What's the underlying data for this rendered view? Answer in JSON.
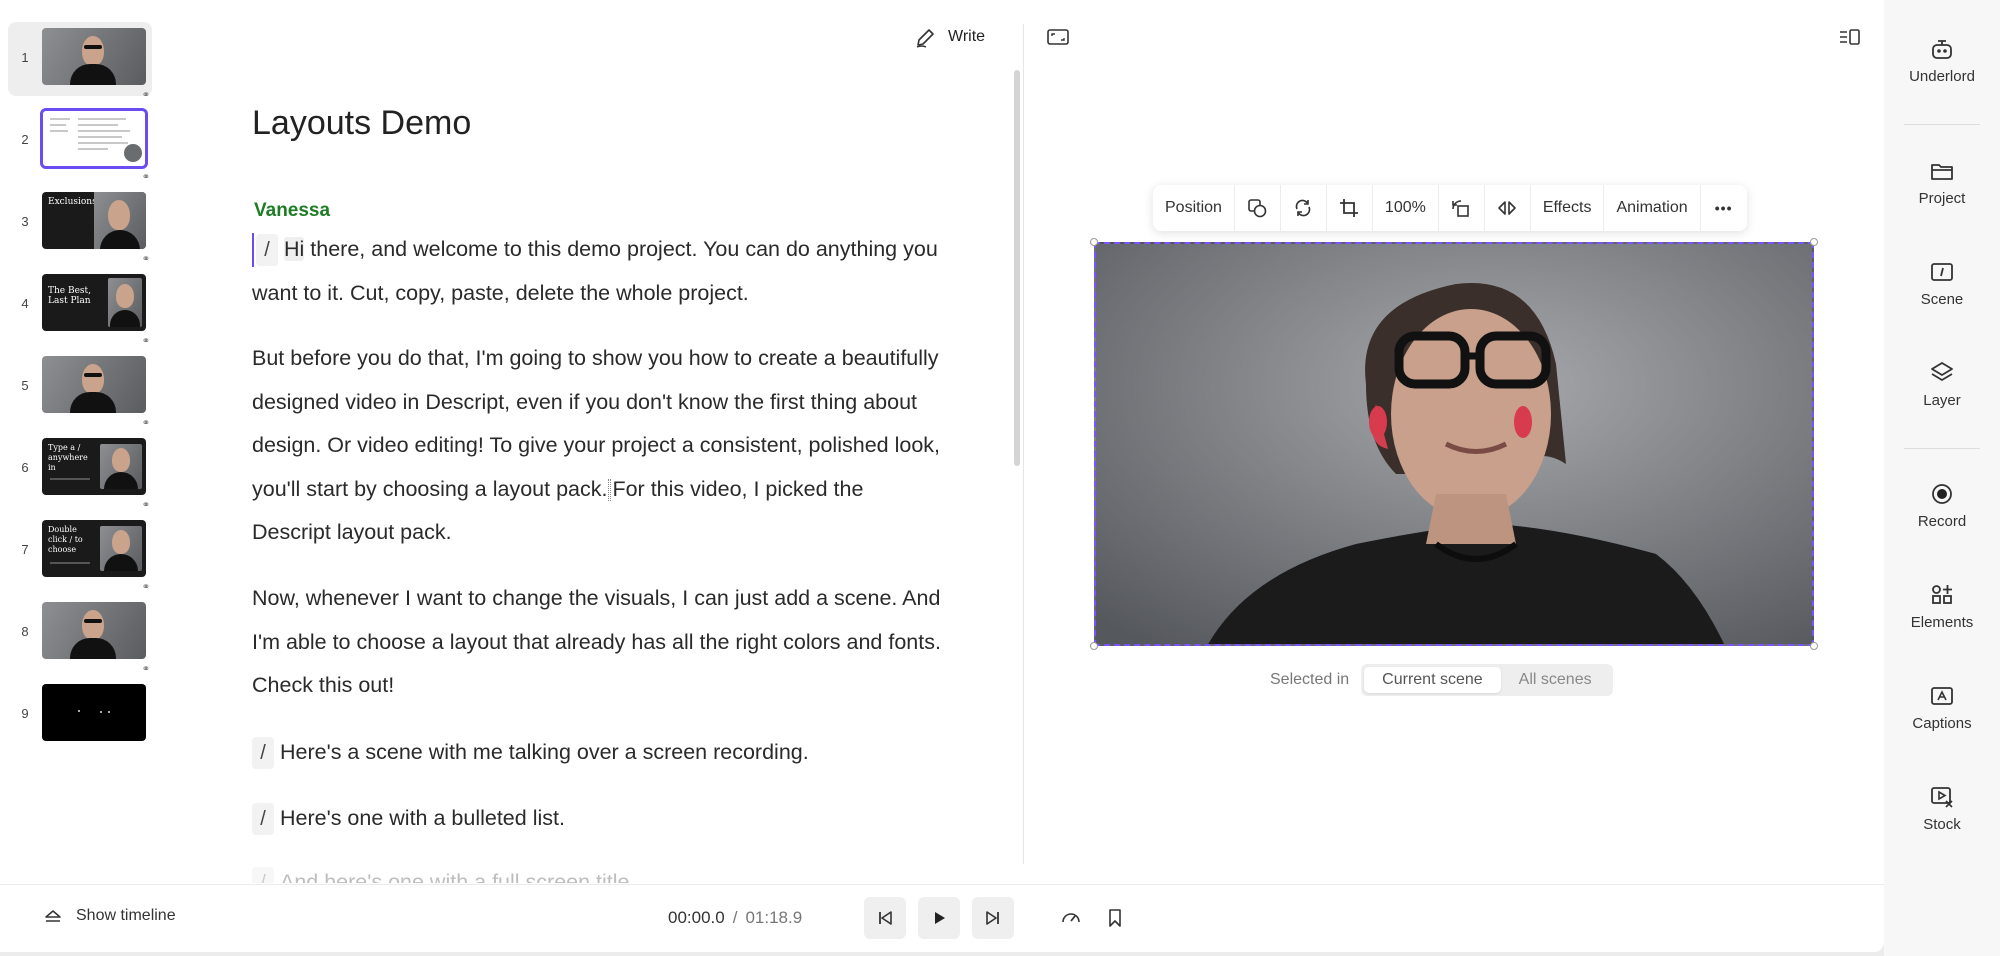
{
  "scenes": [
    {
      "number": "1"
    },
    {
      "number": "2"
    },
    {
      "number": "3",
      "thumb_text": "Exclusions"
    },
    {
      "number": "4",
      "thumb_text": "The Best, Last Plan"
    },
    {
      "number": "5"
    },
    {
      "number": "6",
      "thumb_text": "Type a / anywhere in"
    },
    {
      "number": "7",
      "thumb_text": "Double click / to choose"
    },
    {
      "number": "8"
    },
    {
      "number": "9"
    }
  ],
  "editor": {
    "write_label": "Write",
    "title": "Layouts Demo",
    "speaker": "Vanessa",
    "p1_hi": "Hi",
    "p1_rest": " there, and welcome to this demo project. You can do anything you want to it. Cut, copy, paste, delete the whole project.",
    "p2_a": "But before you do that, I'm going to show you how to create a beautifully designed video in Descript, even if you don't know the first thing about design. Or video editing! To give your project a consistent, polished look, you'll start by choosing a layout pack.",
    "p2_b": "For this video, I picked the Descript layout pack.",
    "p3": "Now, whenever I want to change the visuals, I can just add a scene. And I'm able to choose a layout that already has all the right colors and fonts. Check this out!",
    "p4": "Here's a scene with me talking over a screen recording.",
    "p5": "Here's one with a bulleted list.",
    "p6": "And here's one with a full screen title",
    "slash": "/"
  },
  "toolbar": {
    "position": "Position",
    "zoom": "100%",
    "effects": "Effects",
    "animation": "Animation",
    "more": "•••"
  },
  "selection": {
    "label": "Selected in",
    "current": "Current scene",
    "all": "All scenes"
  },
  "transport": {
    "show_timeline": "Show timeline",
    "current_time": "00:00.0",
    "separator": "/",
    "total_time": "01:18.9"
  },
  "rail": {
    "underlord": "Underlord",
    "project": "Project",
    "scene": "Scene",
    "layer": "Layer",
    "record": "Record",
    "elements": "Elements",
    "captions": "Captions",
    "stock": "Stock"
  },
  "colors": {
    "accent": "#6b4cf0",
    "speaker": "#1e7d24"
  }
}
